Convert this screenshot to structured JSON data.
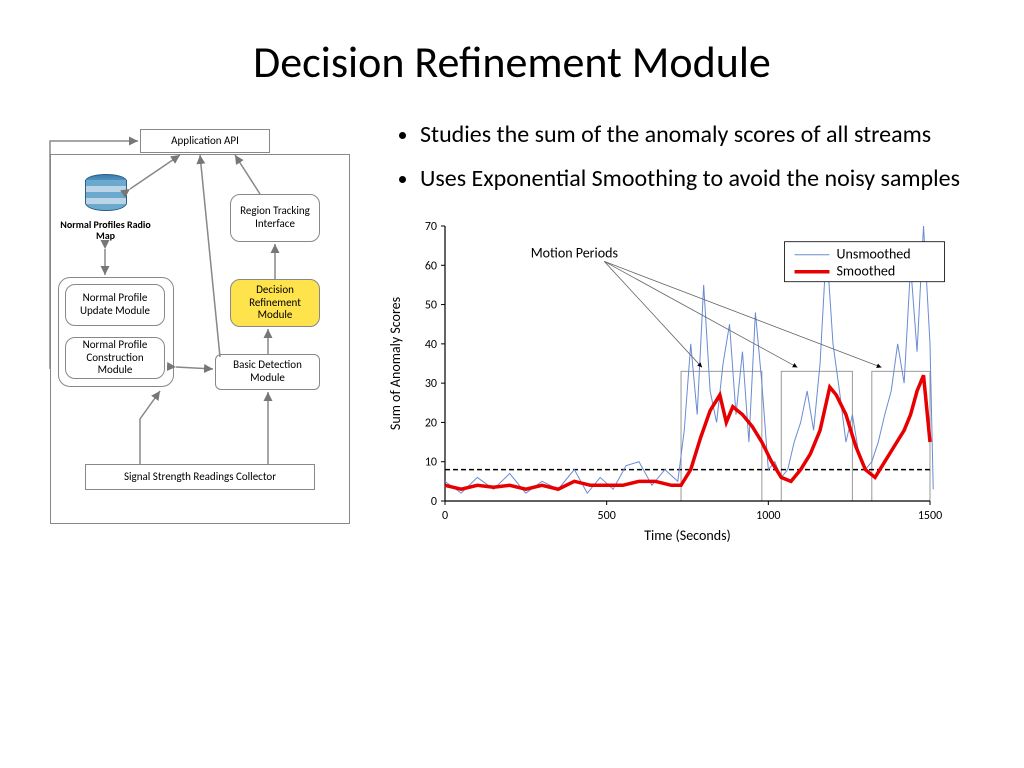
{
  "title": "Decision Refinement Module",
  "bullets": [
    "Studies the sum of the anomaly scores of all streams",
    "Uses Exponential Smoothing to avoid the noisy samples"
  ],
  "flow": {
    "api": "Application API",
    "db_label": "Normal Profiles Radio Map",
    "region": "Region Tracking Interface",
    "drm": "Decision Refinement Module",
    "update": "Normal Profile Update Module",
    "construct": "Normal Profile Construction Module",
    "basic": "Basic Detection Module",
    "collector": "Signal Strength Readings Collector"
  },
  "chart_data": {
    "type": "line",
    "title": "",
    "xlabel": "Time (Seconds)",
    "ylabel": "Sum of Anomaly Scores",
    "xlim": [
      0,
      1500
    ],
    "ylim": [
      0,
      70
    ],
    "annotation": "Motion Periods",
    "threshold": 8,
    "motion_periods": [
      [
        730,
        980
      ],
      [
        1040,
        1260
      ],
      [
        1320,
        1500
      ]
    ],
    "legend": [
      "Unsmoothed",
      "Smoothed"
    ],
    "series": [
      {
        "name": "Unsmoothed",
        "color": "#6a8bd4",
        "x": [
          0,
          50,
          100,
          150,
          200,
          250,
          300,
          350,
          400,
          440,
          480,
          520,
          560,
          600,
          640,
          680,
          720,
          740,
          760,
          780,
          800,
          820,
          840,
          860,
          880,
          900,
          920,
          940,
          960,
          980,
          1000,
          1020,
          1040,
          1060,
          1080,
          1100,
          1120,
          1140,
          1160,
          1180,
          1200,
          1220,
          1240,
          1260,
          1280,
          1300,
          1320,
          1340,
          1360,
          1380,
          1400,
          1420,
          1440,
          1460,
          1480,
          1500,
          1510
        ],
        "values": [
          5,
          2,
          6,
          3,
          7,
          2,
          5,
          3,
          8,
          2,
          6,
          3,
          9,
          10,
          4,
          8,
          5,
          18,
          40,
          22,
          55,
          28,
          20,
          35,
          45,
          22,
          38,
          15,
          48,
          30,
          8,
          10,
          6,
          8,
          15,
          20,
          28,
          18,
          35,
          65,
          40,
          28,
          15,
          22,
          12,
          8,
          10,
          15,
          22,
          28,
          40,
          30,
          60,
          38,
          70,
          40,
          3
        ]
      },
      {
        "name": "Smoothed",
        "color": "#e80000",
        "x": [
          0,
          50,
          100,
          150,
          200,
          250,
          300,
          350,
          400,
          450,
          500,
          550,
          600,
          650,
          700,
          730,
          760,
          790,
          820,
          850,
          870,
          890,
          920,
          950,
          980,
          1010,
          1040,
          1070,
          1100,
          1130,
          1160,
          1190,
          1210,
          1240,
          1270,
          1300,
          1330,
          1360,
          1390,
          1420,
          1440,
          1460,
          1480,
          1500
        ],
        "values": [
          4,
          3,
          4,
          3.5,
          4,
          3,
          4,
          3,
          5,
          4,
          4,
          4,
          5,
          5,
          4,
          4,
          8,
          16,
          23,
          27,
          20,
          24,
          22,
          19,
          15,
          10,
          6,
          5,
          8,
          12,
          18,
          29,
          27,
          22,
          14,
          8,
          6,
          10,
          14,
          18,
          22,
          28,
          32,
          15
        ]
      }
    ],
    "xticks": [
      0,
      500,
      1000,
      1500
    ],
    "yticks": [
      0,
      10,
      20,
      30,
      40,
      50,
      60,
      70
    ]
  }
}
